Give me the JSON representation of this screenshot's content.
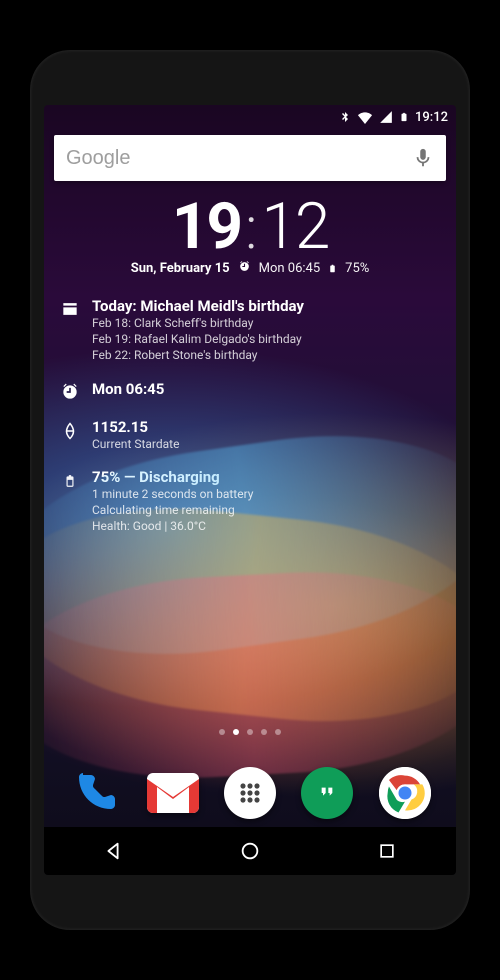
{
  "statusbar": {
    "time": "19:12"
  },
  "search": {
    "placeholder": "Google"
  },
  "clock": {
    "hours": "19",
    "minutes": "12",
    "date": "Sun, February 15",
    "alarm": "Mon 06:45",
    "battery": "75%"
  },
  "cal": {
    "title": "Today: Michael Meidl's birthday",
    "line1": "Feb 18: Clark Scheff's birthday",
    "line2": "Feb 19: Rafael Kalim Delgado's birthday",
    "line3": "Feb 22: Robert Stone's birthday"
  },
  "alarm": {
    "title": "Mon 06:45"
  },
  "stardate": {
    "title": "1152.15",
    "sub": "Current Stardate"
  },
  "battery": {
    "title": "75% — Discharging",
    "line1": "1 minute 2 seconds on battery",
    "line2": "Calculating time remaining",
    "line3": "Health: Good | 36.0°C"
  }
}
